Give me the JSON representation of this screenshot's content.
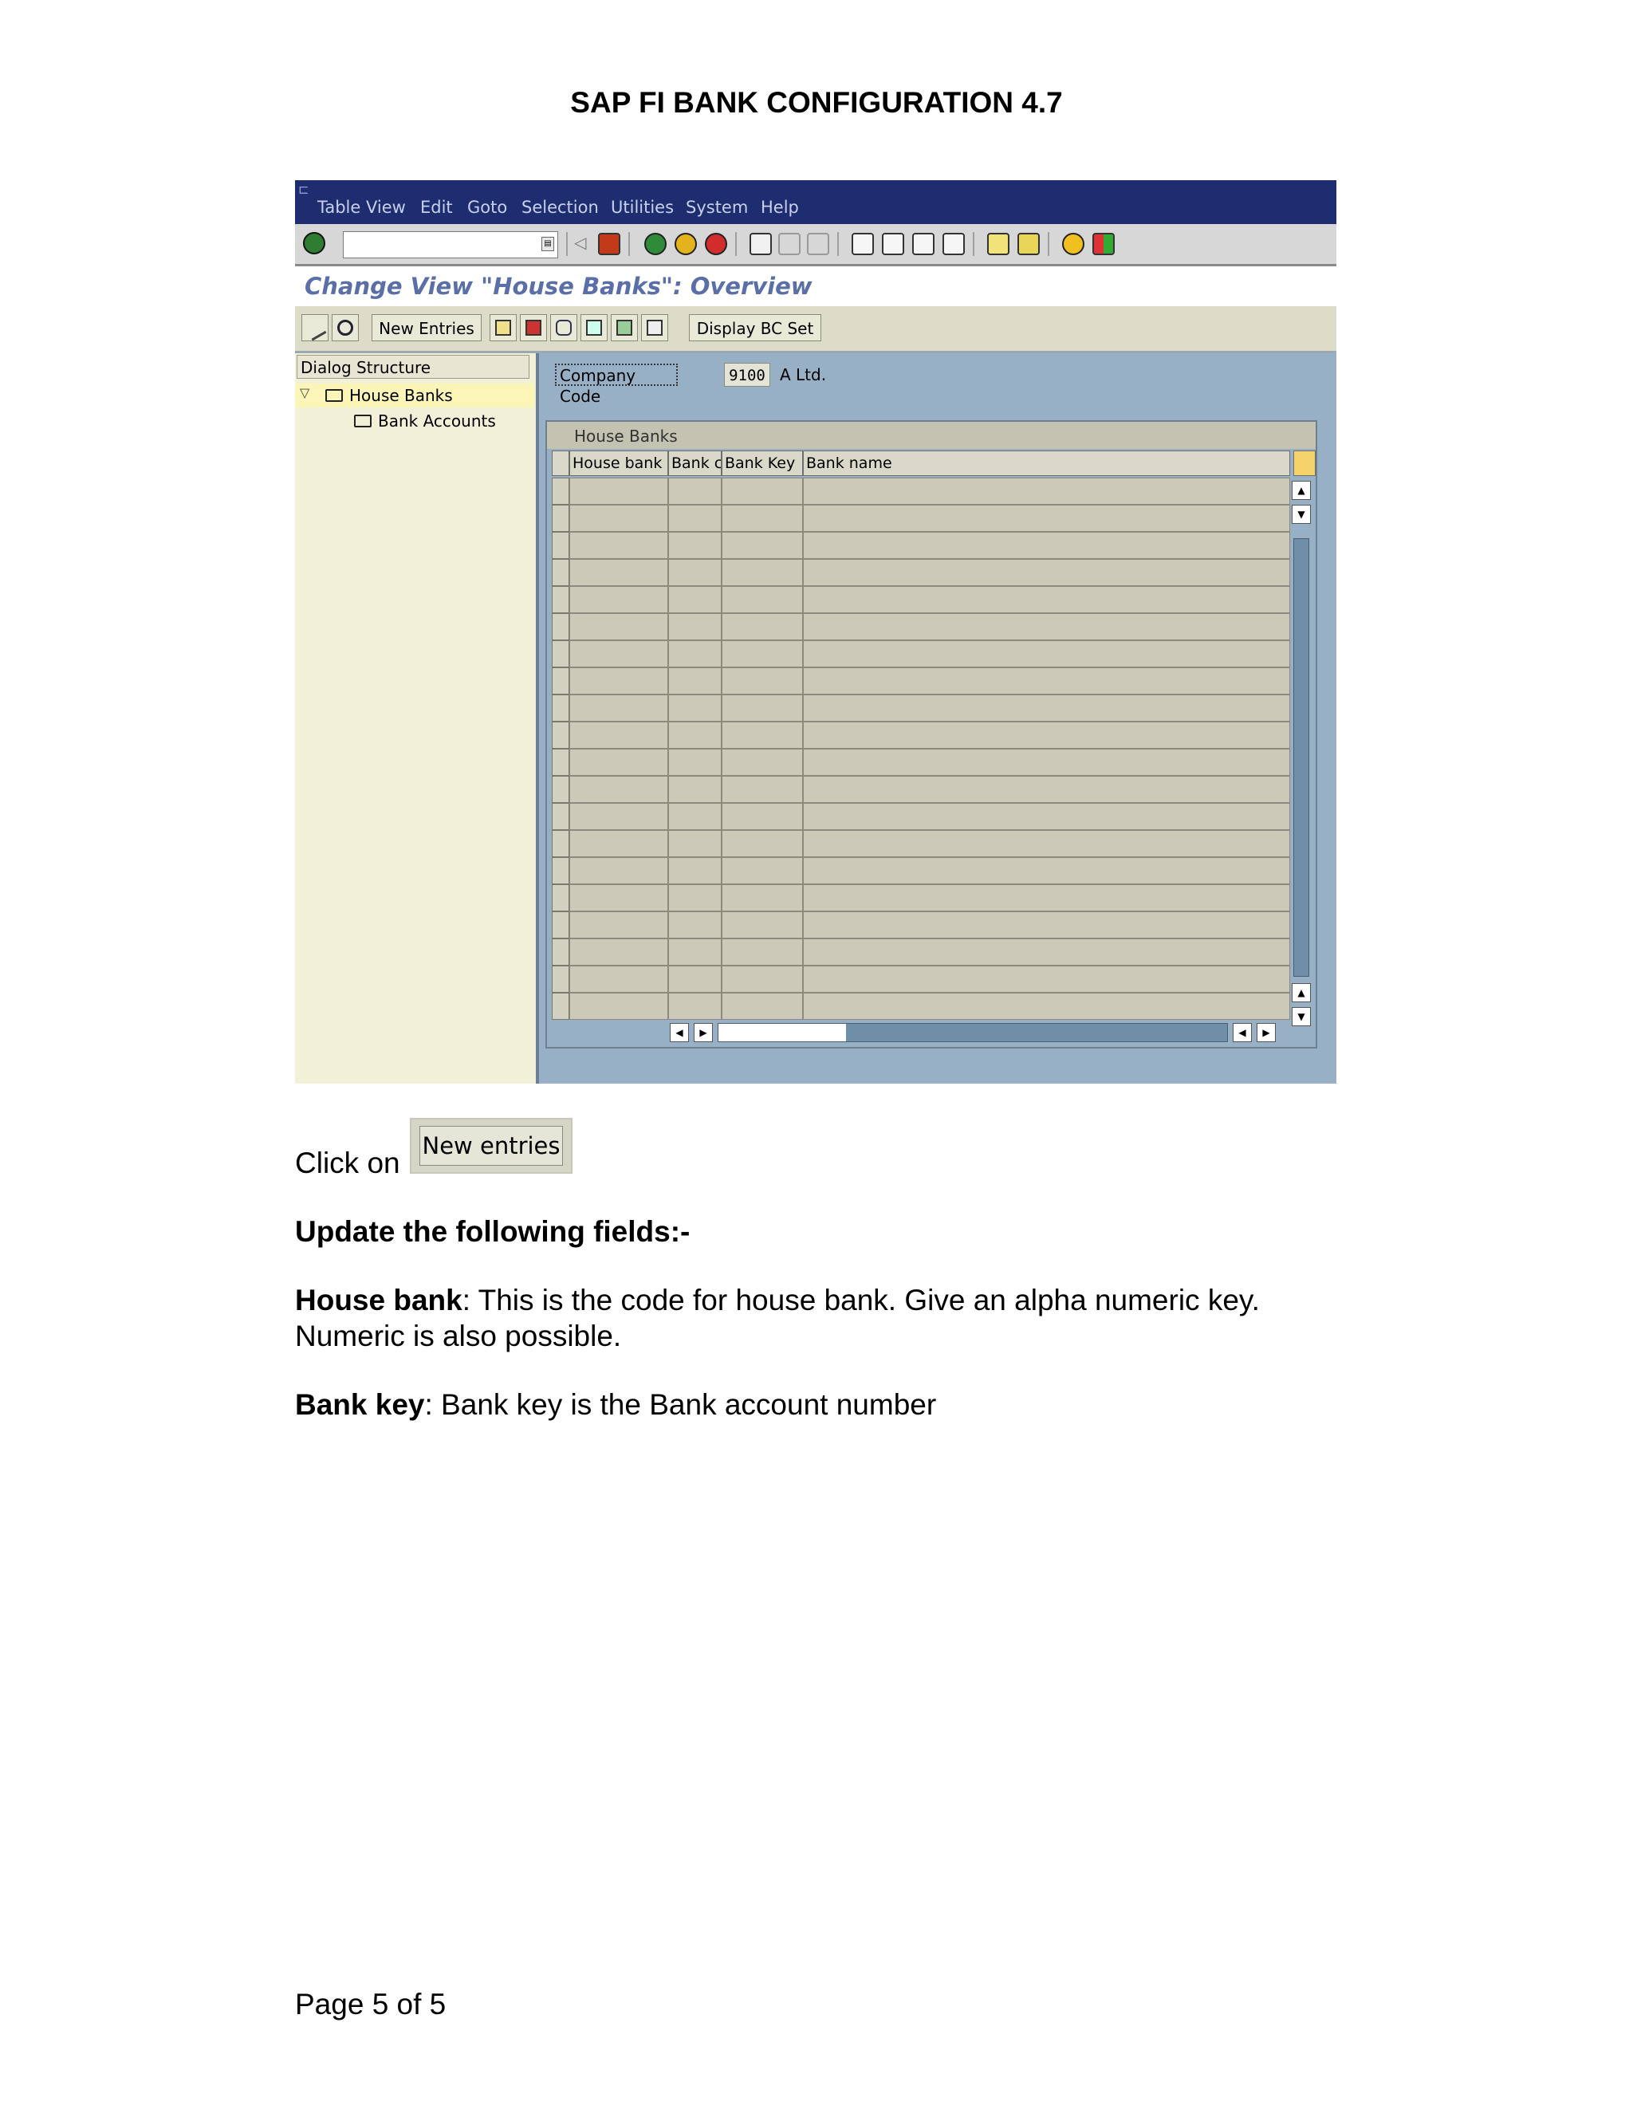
{
  "document": {
    "title": "SAP FI BANK CONFIGURATION 4.7",
    "click_on": "Click on",
    "new_entries_button": "New entries",
    "update_heading": "Update the following fields:-",
    "house_bank_term": "House bank",
    "house_bank_desc": ": This is the code for house bank. Give an alpha numeric key.",
    "house_bank_desc2": "Numeric is also possible.",
    "bank_key_term": "Bank key",
    "bank_key_desc": ": Bank key is the Bank account number",
    "footer": "Page 5 of 5"
  },
  "sap": {
    "menu": [
      "Table View",
      "Edit",
      "Goto",
      "Selection",
      "Utilities",
      "System",
      "Help"
    ],
    "screen_title": "Change View \"House Banks\": Overview",
    "toolbar2": {
      "new_entries": "New Entries",
      "display_bc_set": "Display BC Set"
    },
    "dialog_structure": {
      "header": "Dialog Structure",
      "items": [
        "House Banks",
        "Bank Accounts"
      ]
    },
    "company_code": {
      "label": "Company Code",
      "value": "9100",
      "name": "A Ltd."
    },
    "house_banks_table": {
      "group_title": "House Banks",
      "columns": [
        "House bank",
        "Bank ctry.",
        "Bank Key",
        "Bank name"
      ],
      "row_count": 20
    },
    "colors": {
      "menubar": "#1d2d70",
      "title_text": "#5a6fa8",
      "pane_bg": "#98b0c6",
      "tree_bg": "#f3f0d8",
      "selected_node": "#fbf6b8"
    }
  }
}
